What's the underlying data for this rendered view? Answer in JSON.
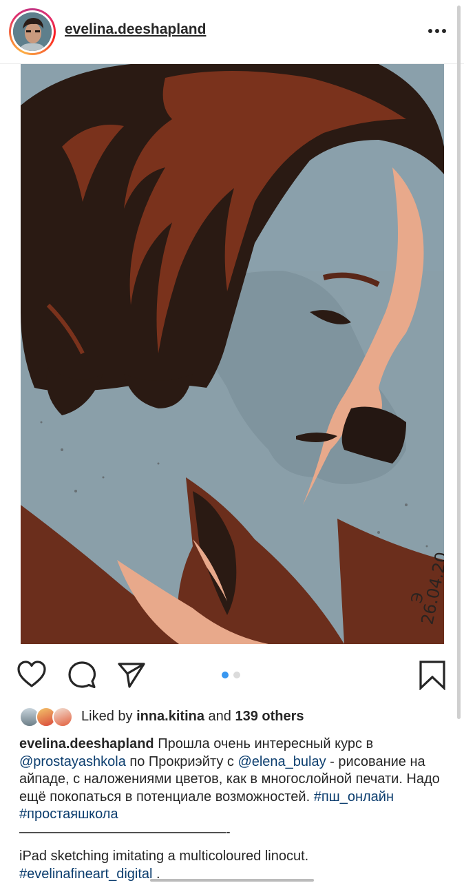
{
  "header": {
    "username": "evelina.deeshapland",
    "avatar": "profile-avatar",
    "more_icon": "more-horizontal-icon"
  },
  "post": {
    "image_signature": "26.04.20",
    "carousel": {
      "count": 2,
      "active_index": 0,
      "active_color": "#3897f0",
      "inactive_color": "#dbdbdb"
    }
  },
  "actions": {
    "like_icon": "heart-icon",
    "comment_icon": "comment-icon",
    "share_icon": "send-icon",
    "save_icon": "bookmark-icon"
  },
  "likes": {
    "prefix": "Liked by ",
    "user": "inna.kitina",
    "middle": " and ",
    "others": "139 others"
  },
  "caption": {
    "username": "evelina.deeshapland",
    "text1": " Прошла очень интересный курс в ",
    "mention1": "@prostayashkola",
    "text2": " по Прокриэйту с ",
    "mention2": "@elena_bulay",
    "text3": " - рисование на айпаде, с наложениями цветов, как в многослойной печати. Надо ещё покопаться в потенциале возможностей. ",
    "hashtag1": "#пш_онлайн",
    "space": " ",
    "hashtag2": "#простаяшкола",
    "divider": "———————————————-",
    "english": "iPad sketching imitating a multicoloured linocut.",
    "hashtag3": "#evelinafineart_digital",
    "end": " ."
  },
  "colors": {
    "link": "#0b3d6e",
    "text": "#262626",
    "accent": "#3897f0"
  }
}
